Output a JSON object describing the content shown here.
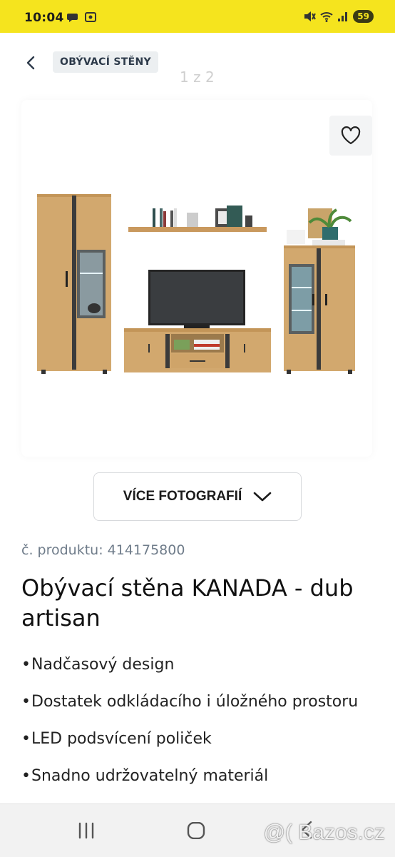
{
  "status_bar": {
    "time": "10:04",
    "battery": "59"
  },
  "header": {
    "breadcrumb": "OBÝVACÍ STĚNY",
    "image_counter": "1 z 2"
  },
  "gallery": {
    "more_photos_label": "VÍCE FOTOGRAFIÍ"
  },
  "product": {
    "code": "č. produktu: 414175800",
    "title": "Obývací stěna KANADA - dub artisan",
    "features": [
      "Nadčasový design",
      "Dostatek odkládacího i úložného prostoru",
      "LED podsvícení poliček",
      "Snadno udržovatelný materiál"
    ]
  },
  "watermark": "@( Bazos.cz",
  "colors": {
    "status_bar": "#f5e41e",
    "oak": "#d2a86e",
    "anthracite": "#3b3b3b",
    "code_text": "#6f7c8a"
  },
  "icons": [
    "chevron-left-icon",
    "close-icon",
    "heart-icon",
    "chevron-down-icon",
    "recent-apps-icon",
    "home-icon",
    "back-icon"
  ]
}
